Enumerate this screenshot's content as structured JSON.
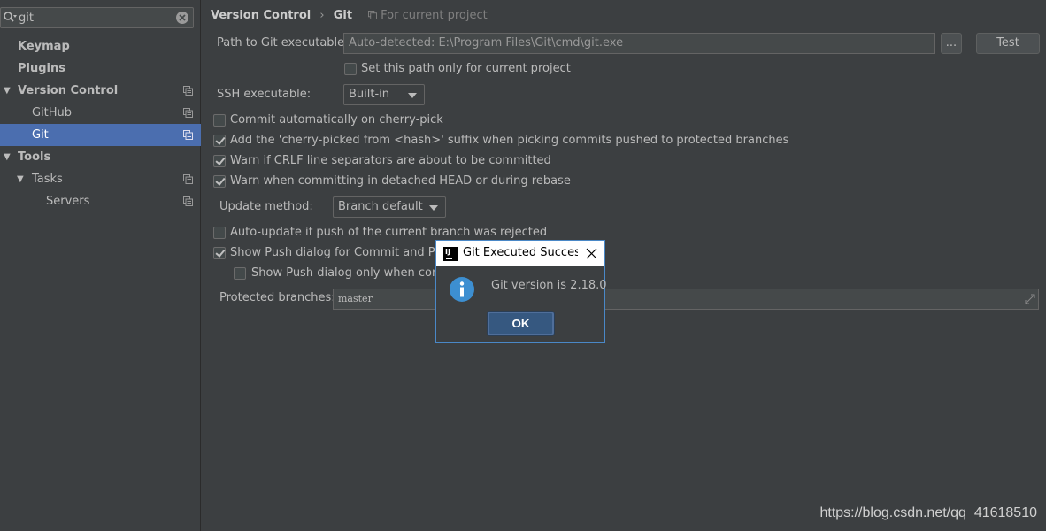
{
  "search": {
    "value": "git"
  },
  "sidebar": {
    "items": [
      {
        "label": "Keymap"
      },
      {
        "label": "Plugins"
      },
      {
        "label": "Version Control"
      },
      {
        "label": "GitHub"
      },
      {
        "label": "Git"
      },
      {
        "label": "Tools"
      },
      {
        "label": "Tasks"
      },
      {
        "label": "Servers"
      }
    ],
    "selected_color": "#4b6eaf"
  },
  "breadcrumb": {
    "parent": "Version Control",
    "separator": "›",
    "current": "Git",
    "scope": "For current project"
  },
  "settings": {
    "path_label": "Path to Git executable:",
    "path_value": "Auto-detected: E:\\Program Files\\Git\\cmd\\git.exe",
    "browse_label": "...",
    "test_label": "Test",
    "path_only_project": "Set this path only for current project",
    "ssh_label": "SSH executable:",
    "ssh_value": "Built-in",
    "commit_cherry_pick": "Commit automatically on cherry-pick",
    "cherry_picked_suffix": "Add the 'cherry-picked from <hash>' suffix when picking commits pushed to protected branches",
    "warn_crlf": "Warn if CRLF line separators are about to be committed",
    "warn_detached": "Warn when committing in detached HEAD or during rebase",
    "update_method_label": "Update method:",
    "update_method_value": "Branch default",
    "auto_update": "Auto-update if push of the current branch was rejected",
    "show_push_dialog": "Show Push dialog for Commit and Push",
    "show_push_only": "Show Push dialog only when commi",
    "protected_label": "Protected branches:",
    "protected_value": "master"
  },
  "dialog": {
    "title": "Git Executed Succes...",
    "message": "Git version is 2.18.0",
    "ok_label": "OK",
    "app_icon_text": "IJ"
  },
  "watermark": "https://blog.csdn.net/qq_41618510",
  "icons": [
    "search-icon",
    "clear-search-icon",
    "copy-icon",
    "expand-arrow-icon",
    "info-icon",
    "close-icon",
    "intellij-icon",
    "expand-field-icon"
  ]
}
